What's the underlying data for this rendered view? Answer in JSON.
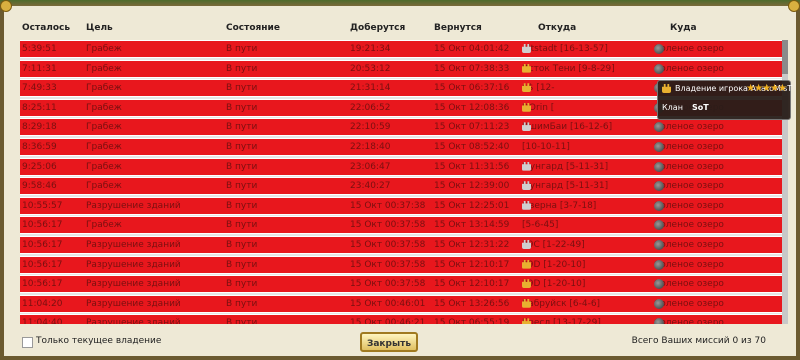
{
  "columns": [
    "Осталось",
    "Цель",
    "Состояние",
    "Доберутся",
    "Вернутся",
    "Откуда",
    "Куда"
  ],
  "rows": [
    {
      "remaining": "5:39:51",
      "target": "Грабеж",
      "state": "В пути",
      "arrive": "19:21:34",
      "return": "15 Окт 04:01:42",
      "from": "Altstadt [16-13-57]",
      "from_icon": "castle",
      "to": "Соленое озеро"
    },
    {
      "remaining": "7:11:31",
      "target": "Грабеж",
      "state": "В пути",
      "arrive": "20:53:12",
      "return": "15 Окт 07:38:33",
      "from": "Исток Тени [9-8-29]",
      "from_icon": "castle-gold",
      "to": "Соленое озеро"
    },
    {
      "remaining": "7:49:33",
      "target": "Грабеж",
      "state": "В пути",
      "arrive": "21:31:14",
      "return": "15 Окт 06:37:16",
      "from": "$$ [12-",
      "from_icon": "castle-gold",
      "to": "Соленое озеро"
    },
    {
      "remaining": "8:25:11",
      "target": "Грабеж",
      "state": "В пути",
      "arrive": "22:06:52",
      "return": "15 Окт 12:08:36",
      "from": "DOrin [",
      "from_icon": "castle-gold",
      "to": "Соленое озеро"
    },
    {
      "remaining": "8:29:18",
      "target": "Грабеж",
      "state": "В пути",
      "arrive": "22:10:59",
      "return": "15 Окт 07:11:23",
      "from": "ИшимБаи [16-12-6]",
      "from_icon": "castle",
      "to": "Соленое озеро"
    },
    {
      "remaining": "8:36:59",
      "target": "Грабеж",
      "state": "В пути",
      "arrive": "22:18:40",
      "return": "15 Окт 08:52:40",
      "from": "[10-10-11]",
      "from_icon": "none",
      "to": "Соленое озеро"
    },
    {
      "remaining": "9:25:06",
      "target": "Грабеж",
      "state": "В пути",
      "arrive": "23:06:47",
      "return": "15 Окт 11:31:56",
      "from": "Мунгард [5-11-31]",
      "from_icon": "castle",
      "to": "Соленое озеро"
    },
    {
      "remaining": "9:58:46",
      "target": "Грабеж",
      "state": "В пути",
      "arrive": "23:40:27",
      "return": "15 Окт 12:39:00",
      "from": "Мунгард [5-11-31]",
      "from_icon": "castle",
      "to": "Соленое озеро"
    },
    {
      "remaining": "10:55:57",
      "target": "Разрушение зданий",
      "state": "В пути",
      "arrive": "15 Окт 00:37:38",
      "return": "15 Окт 12:25:01",
      "from": "Оверна [3-7-18]",
      "from_icon": "castle",
      "to": "Соленое озеро"
    },
    {
      "remaining": "10:56:17",
      "target": "Грабеж",
      "state": "В пути",
      "arrive": "15 Окт 00:37:58",
      "return": "15 Окт 13:14:59",
      "from": "[5-6-45]",
      "from_icon": "none",
      "to": "Соленое озеро"
    },
    {
      "remaining": "10:56:17",
      "target": "Разрушение зданий",
      "state": "В пути",
      "arrive": "15 Окт 00:37:58",
      "return": "15 Окт 12:31:22",
      "from": "29С [1-22-49]",
      "from_icon": "castle",
      "to": "Соленое озеро"
    },
    {
      "remaining": "10:56:17",
      "target": "Разрушение зданий",
      "state": "В пути",
      "arrive": "15 Окт 00:37:58",
      "return": "15 Окт 12:10:17",
      "from": "29D [1-20-10]",
      "from_icon": "castle-gold",
      "to": "Соленое озеро"
    },
    {
      "remaining": "10:56:17",
      "target": "Разрушение зданий",
      "state": "В пути",
      "arrive": "15 Окт 00:37:58",
      "return": "15 Окт 12:10:17",
      "from": "29D [1-20-10]",
      "from_icon": "castle-gold",
      "to": "Соленое озеро"
    },
    {
      "remaining": "11:04:20",
      "target": "Разрушение зданий",
      "state": "В пути",
      "arrive": "15 Окт 00:46:01",
      "return": "15 Окт 13:26:56",
      "from": "Бабруйск [6-4-6]",
      "from_icon": "castle-gold",
      "to": "Соленое озеро"
    },
    {
      "remaining": "11:04:40",
      "target": "Разрушение зданий",
      "state": "В пути",
      "arrive": "15 Окт 00:46:21",
      "return": "15 Окт 06:55:19",
      "from": "Бресл [13-17-29]",
      "from_icon": "castle-gold",
      "to": "Соленое озеро"
    }
  ],
  "tooltip": {
    "title": "Владение игрока AnatoMisT",
    "stars": "★★★★★",
    "clan_label": "Клан",
    "clan_value": "SoT"
  },
  "footer": {
    "checkbox_label": "Только текущее владение",
    "close_label": "Закрыть",
    "missions_text": "Всего Ваших миссий 0 из 70"
  },
  "colors": {
    "row_bg": "#e8171d",
    "row_text": "#7a1010"
  }
}
